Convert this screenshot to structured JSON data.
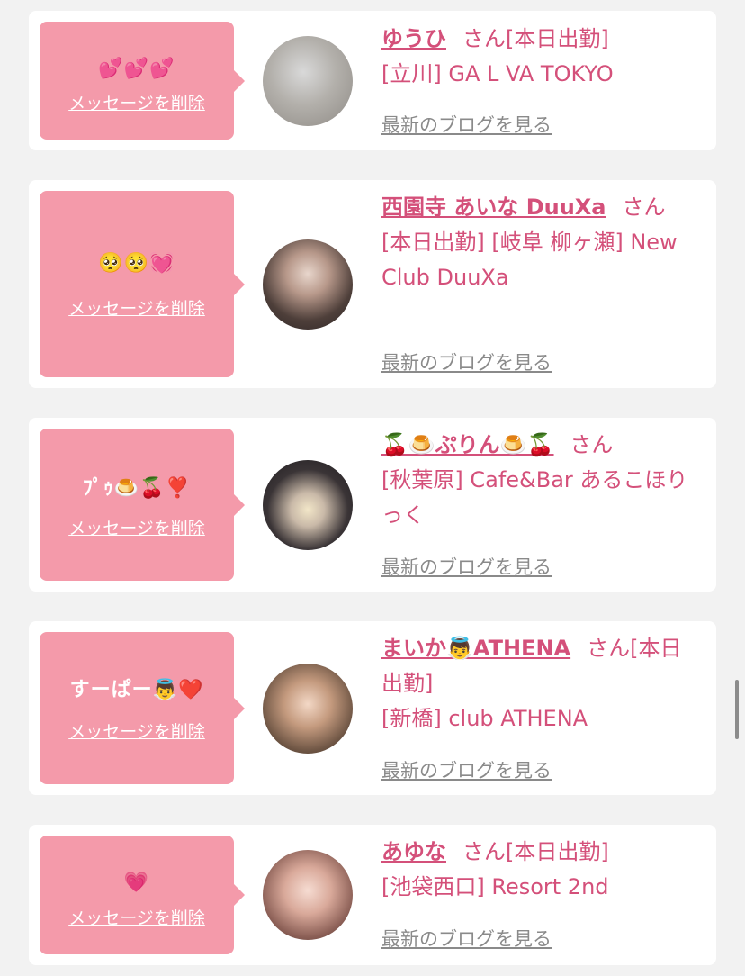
{
  "delete_label": "メッセージを削除",
  "san_label": "さん",
  "blog_label": "最新のブログを見る",
  "colors": {
    "background": "#f2f2f2",
    "card": "#ffffff",
    "bubble": "#f49aaa",
    "accent_text": "#d4507a",
    "link_gray": "#8a8a8a"
  },
  "entries": [
    {
      "message": "💕💕💕",
      "name": "ゆうひ",
      "after_name": "さん[本日出勤]",
      "shop_text": "[立川] GA L VA TOKYO"
    },
    {
      "message": "🥺🥺💓",
      "name": "西園寺 あいな DuuXa",
      "after_name": "さん",
      "shop_text": "[本日出勤] [岐阜 柳ヶ瀬] New Club DuuXa"
    },
    {
      "message": "ﾌﾟｩ🍮🍒❣️",
      "name": "🍒🍮ぷりん🍮🍒",
      "after_name": "さん",
      "shop_text": "[秋葉原] Cafe&Bar あるこほりっく"
    },
    {
      "message": "すーぱー👼❤️",
      "name": "まいか👼ATHENA",
      "after_name": "さん[本日出勤]",
      "shop_text": "[新橋] club ATHENA"
    },
    {
      "message": "💗",
      "name": "あゆな",
      "after_name": "さん[本日出勤]",
      "shop_text": "[池袋西口] Resort 2nd"
    }
  ]
}
